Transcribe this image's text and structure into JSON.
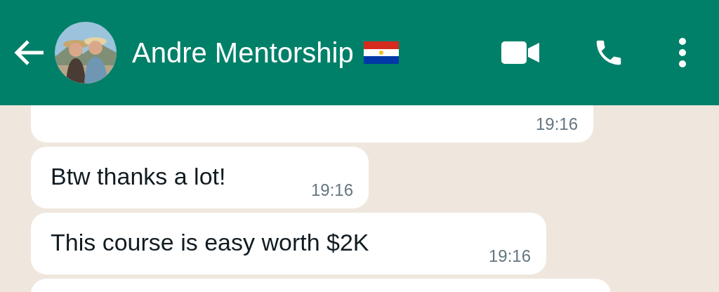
{
  "header": {
    "title": "Andre Mentorship"
  },
  "messages": [
    {
      "time": "19:16",
      "cut_top": true
    },
    {
      "text": "Btw thanks a lot!",
      "time": "19:16"
    },
    {
      "text": "This course is easy worth $2K",
      "time": "19:16"
    },
    {
      "cut_bottom": true
    }
  ]
}
